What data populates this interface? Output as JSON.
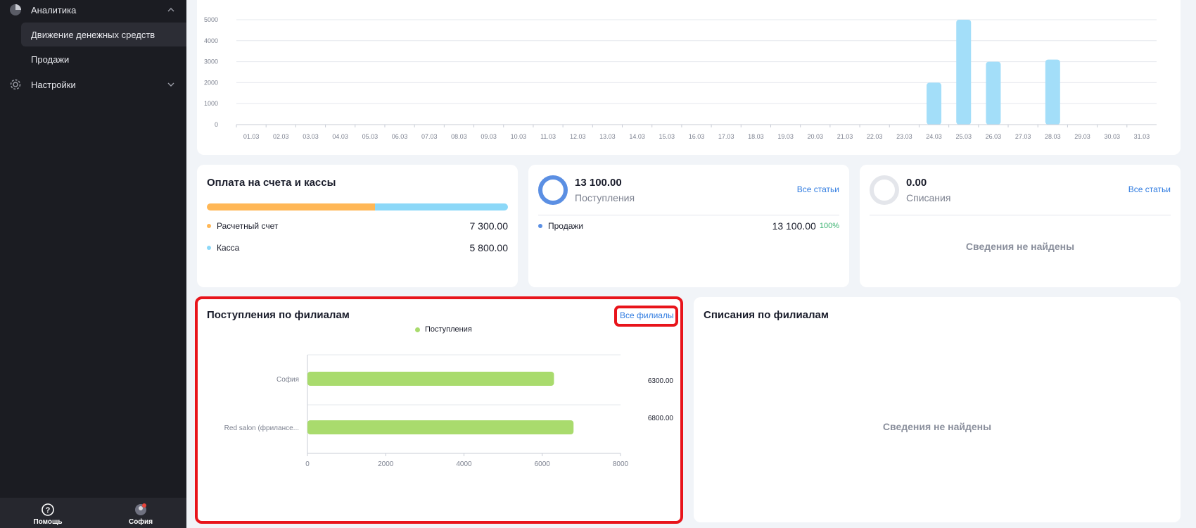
{
  "sidebar": {
    "items": [
      {
        "label": "Аналитика",
        "icon": "pie-chart-icon"
      },
      {
        "label": "Движение денежных средств"
      },
      {
        "label": "Продажи"
      },
      {
        "label": "Настройки",
        "icon": "gear-icon"
      }
    ],
    "bottom": {
      "help_label": "Помощь",
      "user_label": "София"
    }
  },
  "top_chart": {
    "chart_data": {
      "type": "bar",
      "categories": [
        "01.03",
        "02.03",
        "03.03",
        "04.03",
        "05.03",
        "06.03",
        "07.03",
        "08.03",
        "09.03",
        "10.03",
        "11.03",
        "12.03",
        "13.03",
        "14.03",
        "15.03",
        "16.03",
        "17.03",
        "18.03",
        "19.03",
        "20.03",
        "21.03",
        "22.03",
        "23.03",
        "24.03",
        "25.03",
        "26.03",
        "27.03",
        "28.03",
        "29.03",
        "30.03",
        "31.03"
      ],
      "values": [
        0,
        0,
        0,
        0,
        0,
        0,
        0,
        0,
        0,
        0,
        0,
        0,
        0,
        0,
        0,
        0,
        0,
        0,
        0,
        0,
        0,
        0,
        0,
        2000,
        5000,
        3000,
        0,
        3100,
        0,
        0,
        0
      ],
      "yticks": [
        "0",
        "1000",
        "2000",
        "3000",
        "4000",
        "5000"
      ],
      "ylim": [
        0,
        5000
      ],
      "color": "#a3def9"
    }
  },
  "payments": {
    "title": "Оплата на счета и кассы",
    "rows": [
      {
        "label": "Расчетный счет",
        "value": "7 300.00",
        "color": "#ffb756"
      },
      {
        "label": "Касса",
        "value": "5 800.00",
        "color": "#8cd8f8"
      }
    ],
    "share": [
      7300,
      5800
    ]
  },
  "income": {
    "amount": "13 100.00",
    "label": "Поступления",
    "link": "Все статьи",
    "ring_color": "#5b8fe3",
    "rows": [
      {
        "label": "Продажи",
        "value": "13 100.00",
        "percent": "100%"
      }
    ]
  },
  "expense": {
    "amount": "0.00",
    "label": "Списания",
    "link": "Все статьи",
    "empty": "Сведения не найдены"
  },
  "income_branches": {
    "title": "Поступления по филиалам",
    "link": "Все филиалы",
    "legend": "Поступления",
    "chart_data": {
      "type": "bar",
      "orientation": "horizontal",
      "categories": [
        "София",
        "Red salon (фрилансe..."
      ],
      "values": [
        6300,
        6800
      ],
      "value_labels": [
        "6300.00",
        "6800.00"
      ],
      "xticks": [
        "0",
        "2000",
        "4000",
        "6000",
        "8000"
      ],
      "xlim": [
        0,
        8000
      ],
      "color": "#a9db6d"
    }
  },
  "expense_branches": {
    "title": "Списания по филиалам",
    "empty": "Сведения не найдены"
  }
}
